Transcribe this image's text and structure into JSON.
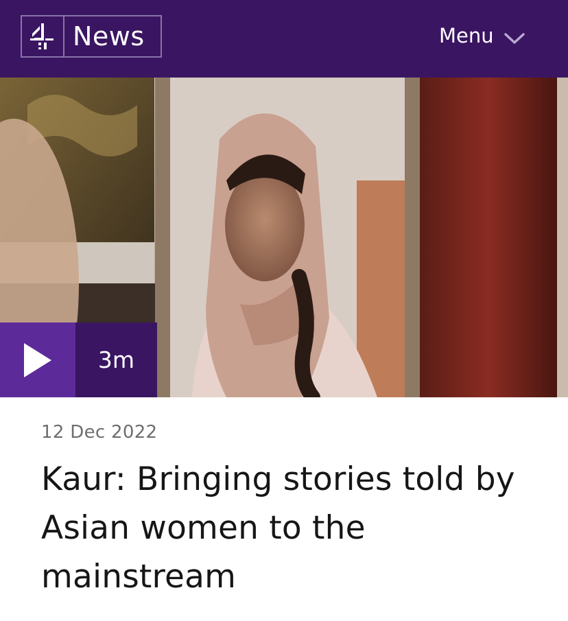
{
  "header": {
    "logo_icon": "channel-4-logo-icon",
    "logo_text": "News",
    "menu_label": "Menu",
    "menu_icon": "chevron-down-icon",
    "bg_color": "#3a1562"
  },
  "video": {
    "play_icon": "play-icon",
    "duration": "3m",
    "accent_color": "#5d2a9a"
  },
  "article": {
    "date": "12 Dec 2022",
    "headline": "Kaur: Bringing stories told by Asian women to the mainstream"
  }
}
